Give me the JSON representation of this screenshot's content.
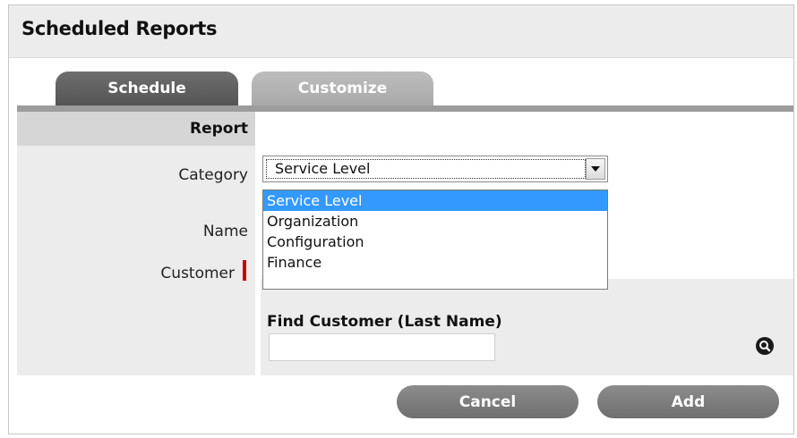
{
  "page": {
    "title": "Scheduled Reports"
  },
  "tabs": [
    {
      "label": "Schedule",
      "active": true
    },
    {
      "label": "Customize",
      "active": false
    }
  ],
  "form": {
    "section_title": "Report",
    "category_label": "Category",
    "category_value": "Service Level",
    "category_options": [
      "Service Level",
      "Organization",
      "Configuration",
      "Finance"
    ],
    "name_label": "Name",
    "customer_label": "Customer",
    "customer_required": true,
    "finder": {
      "title": "Find Customer (Last Name)",
      "value": "",
      "search_icon": "search-icon"
    }
  },
  "buttons": {
    "cancel": "Cancel",
    "add": "Add"
  },
  "colors": {
    "tab_active": "#606060",
    "tab_inactive": "#b3b3b3",
    "option_highlight": "#3399ff",
    "required_marker": "#cc0000",
    "button": "#7c7c7c"
  }
}
